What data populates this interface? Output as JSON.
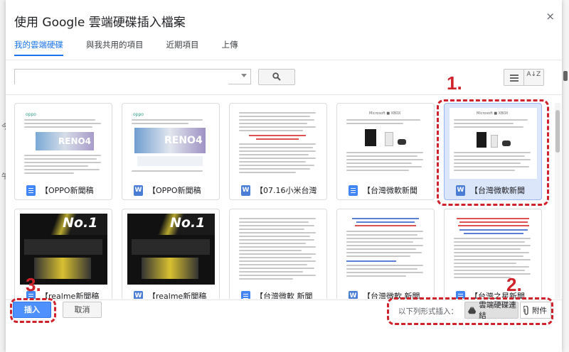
{
  "dialog": {
    "title": "使用 Google 雲端硬碟插入檔案",
    "close": "×"
  },
  "tabs": [
    {
      "label": "我的雲端硬碟",
      "active": true
    },
    {
      "label": "與我共用的項目",
      "active": false
    },
    {
      "label": "近期項目",
      "active": false
    },
    {
      "label": "上傳",
      "active": false
    }
  ],
  "toolbar": {
    "search_value": "",
    "sort_icon": "A↓Z"
  },
  "files": [
    {
      "name": "【OPPO新聞稿",
      "type": "gdoc",
      "selected": false
    },
    {
      "name": "【OPPO新聞稿",
      "type": "word",
      "selected": false
    },
    {
      "name": "【07.16小米台灣",
      "type": "word",
      "selected": false
    },
    {
      "name": "【台灣微軟新聞",
      "type": "gdoc",
      "selected": false
    },
    {
      "name": "【台灣微軟新聞",
      "type": "word",
      "selected": true
    },
    {
      "name": "【realme新聞稿",
      "type": "gdoc",
      "selected": false
    },
    {
      "name": "【realme新聞稿",
      "type": "word",
      "selected": false
    },
    {
      "name": "【台灣微軟 新聞",
      "type": "gdoc",
      "selected": false
    },
    {
      "name": "【台灣微軟 新聞",
      "type": "word",
      "selected": false
    },
    {
      "name": "【台灣之星新聞",
      "type": "gdoc",
      "selected": false
    }
  ],
  "thumbs": {
    "oppo_brand": "oppo",
    "reno": "RENO4",
    "no1": "No.1",
    "microsoft": "Microsoft ■ XBOX"
  },
  "footer": {
    "insert_label": "插入",
    "cancel_label": "取消",
    "insert_as_label": "以下列形式插入：",
    "drive_link_label": "雲端硬碟連結",
    "attachment_label": "附件"
  },
  "annotations": {
    "one": "1.",
    "two": "2.",
    "three": "3."
  },
  "colors": {
    "accent": "#1a73e8",
    "callout": "#d0222b",
    "insert_button": "#4d90fe",
    "selected_card": "#dbe6fb"
  }
}
